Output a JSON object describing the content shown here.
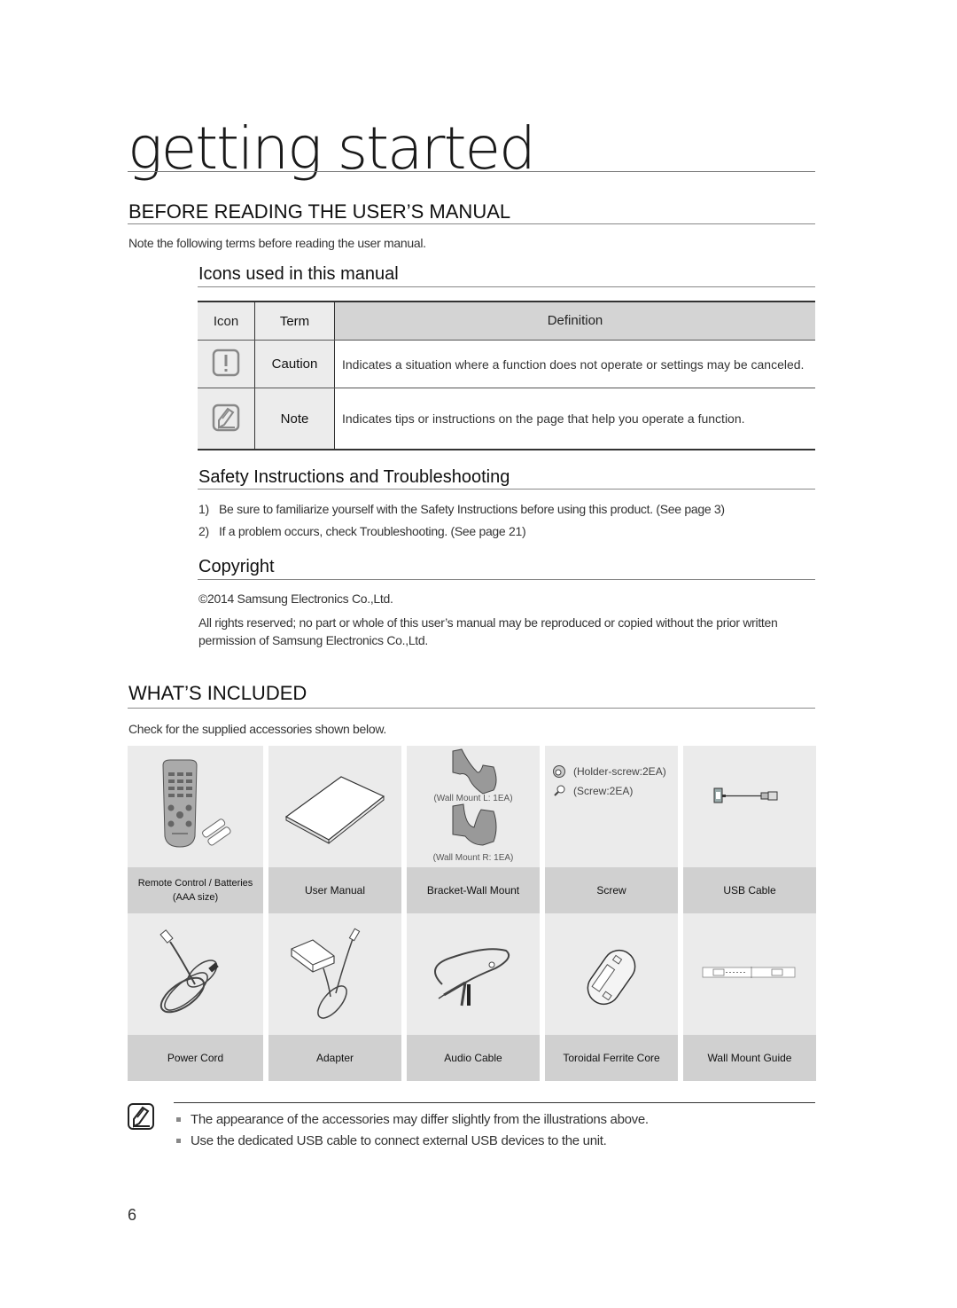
{
  "chapter_title": "getting started",
  "before_reading": {
    "heading": "BEFORE READING THE USER’S MANUAL",
    "intro": "Note the following terms before reading the user manual.",
    "icons_section": {
      "heading": "Icons used in this manual",
      "columns": [
        "Icon",
        "Term",
        "Definition"
      ],
      "rows": [
        {
          "icon": "caution-icon",
          "term": "Caution",
          "definition": "Indicates a situation where a function does not operate or settings may be canceled."
        },
        {
          "icon": "note-icon",
          "term": "Note",
          "definition": "Indicates tips or instructions on the page that help you operate a function."
        }
      ]
    },
    "safety_section": {
      "heading": "Safety Instructions and Troubleshooting",
      "items": [
        {
          "num": "1)",
          "text": "Be sure to familiarize yourself with the Safety Instructions before using this product. (See page 3)"
        },
        {
          "num": "2)",
          "text": "If a problem occurs, check Troubleshooting. (See page 21)"
        }
      ]
    },
    "copyright_section": {
      "heading": "Copyright",
      "line1": "©2014 Samsung Electronics Co.,Ltd.",
      "line2": "All rights reserved; no part or whole of this user’s manual may be reproduced or copied without the prior written permission of Samsung Electronics Co.,Ltd."
    }
  },
  "whats_included": {
    "heading": "WHAT’S INCLUDED",
    "intro": "Check for the supplied accessories shown below.",
    "accessories": [
      {
        "label": "Remote Control / Batteries (AAA size)",
        "icon": "remote-control-icon"
      },
      {
        "label": "User Manual",
        "icon": "user-manual-icon"
      },
      {
        "label": "Bracket-Wall Mount",
        "icon": "wall-mount-bracket-icon",
        "captions": [
          "(Wall Mount L: 1EA)",
          "(Wall Mount R: 1EA)"
        ]
      },
      {
        "label": "Screw",
        "icon": "screw-icon",
        "captions": [
          "(Holder-screw:2EA)",
          "(Screw:2EA)"
        ]
      },
      {
        "label": "USB Cable",
        "icon": "usb-cable-icon"
      },
      {
        "label": "Power Cord",
        "icon": "power-cord-icon"
      },
      {
        "label": "Adapter",
        "icon": "adapter-icon"
      },
      {
        "label": "Audio Cable",
        "icon": "audio-cable-icon"
      },
      {
        "label": "Toroidal Ferrite Core",
        "icon": "ferrite-core-icon"
      },
      {
        "label": "Wall Mount Guide",
        "icon": "wall-mount-guide-icon"
      }
    ],
    "notes": [
      "The appearance of the accessories may differ slightly from the illustrations above.",
      "Use the dedicated USB cable to connect external USB devices to the unit."
    ]
  },
  "page_number": "6"
}
